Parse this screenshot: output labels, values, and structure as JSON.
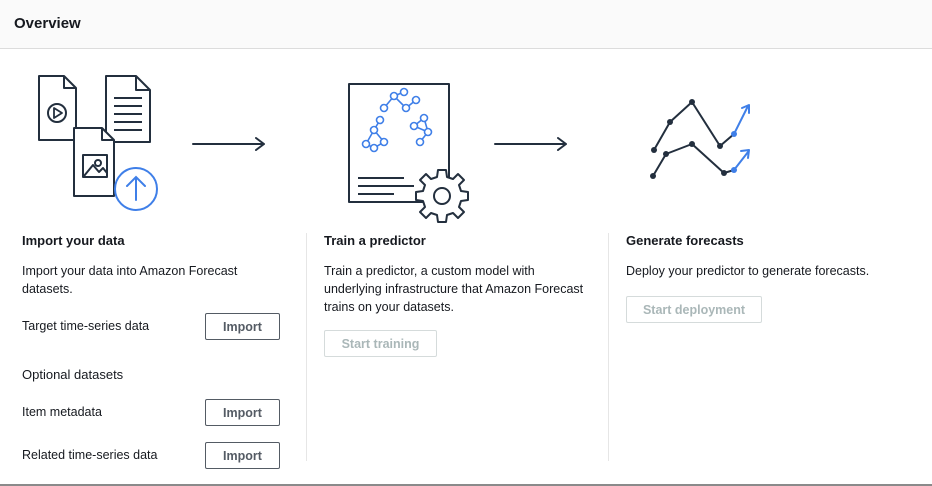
{
  "header": {
    "title": "Overview"
  },
  "steps": [
    {
      "title": "Import your data",
      "description": "Import your data into Amazon Forecast datasets.",
      "icon": "import-data-illustration"
    },
    {
      "title": "Train a predictor",
      "description": "Train a predictor, a custom model with underlying infrastructure that Amazon Forecast trains on your datasets.",
      "button": {
        "label": "Start training",
        "disabled": true
      },
      "icon": "train-predictor-illustration"
    },
    {
      "title": "Generate forecasts",
      "description": "Deploy your predictor to generate forecasts.",
      "button": {
        "label": "Start deployment",
        "disabled": true
      },
      "icon": "forecast-chart-illustration"
    }
  ],
  "import": {
    "target_label": "Target time-series data",
    "optional_heading": "Optional datasets",
    "item_metadata_label": "Item metadata",
    "related_label": "Related time-series data",
    "button_label": "Import"
  },
  "colors": {
    "accent_blue": "#3f7fe8",
    "line_dark": "#232f3e",
    "disabled_text": "#aab7b8",
    "button_border": "#545b64"
  }
}
